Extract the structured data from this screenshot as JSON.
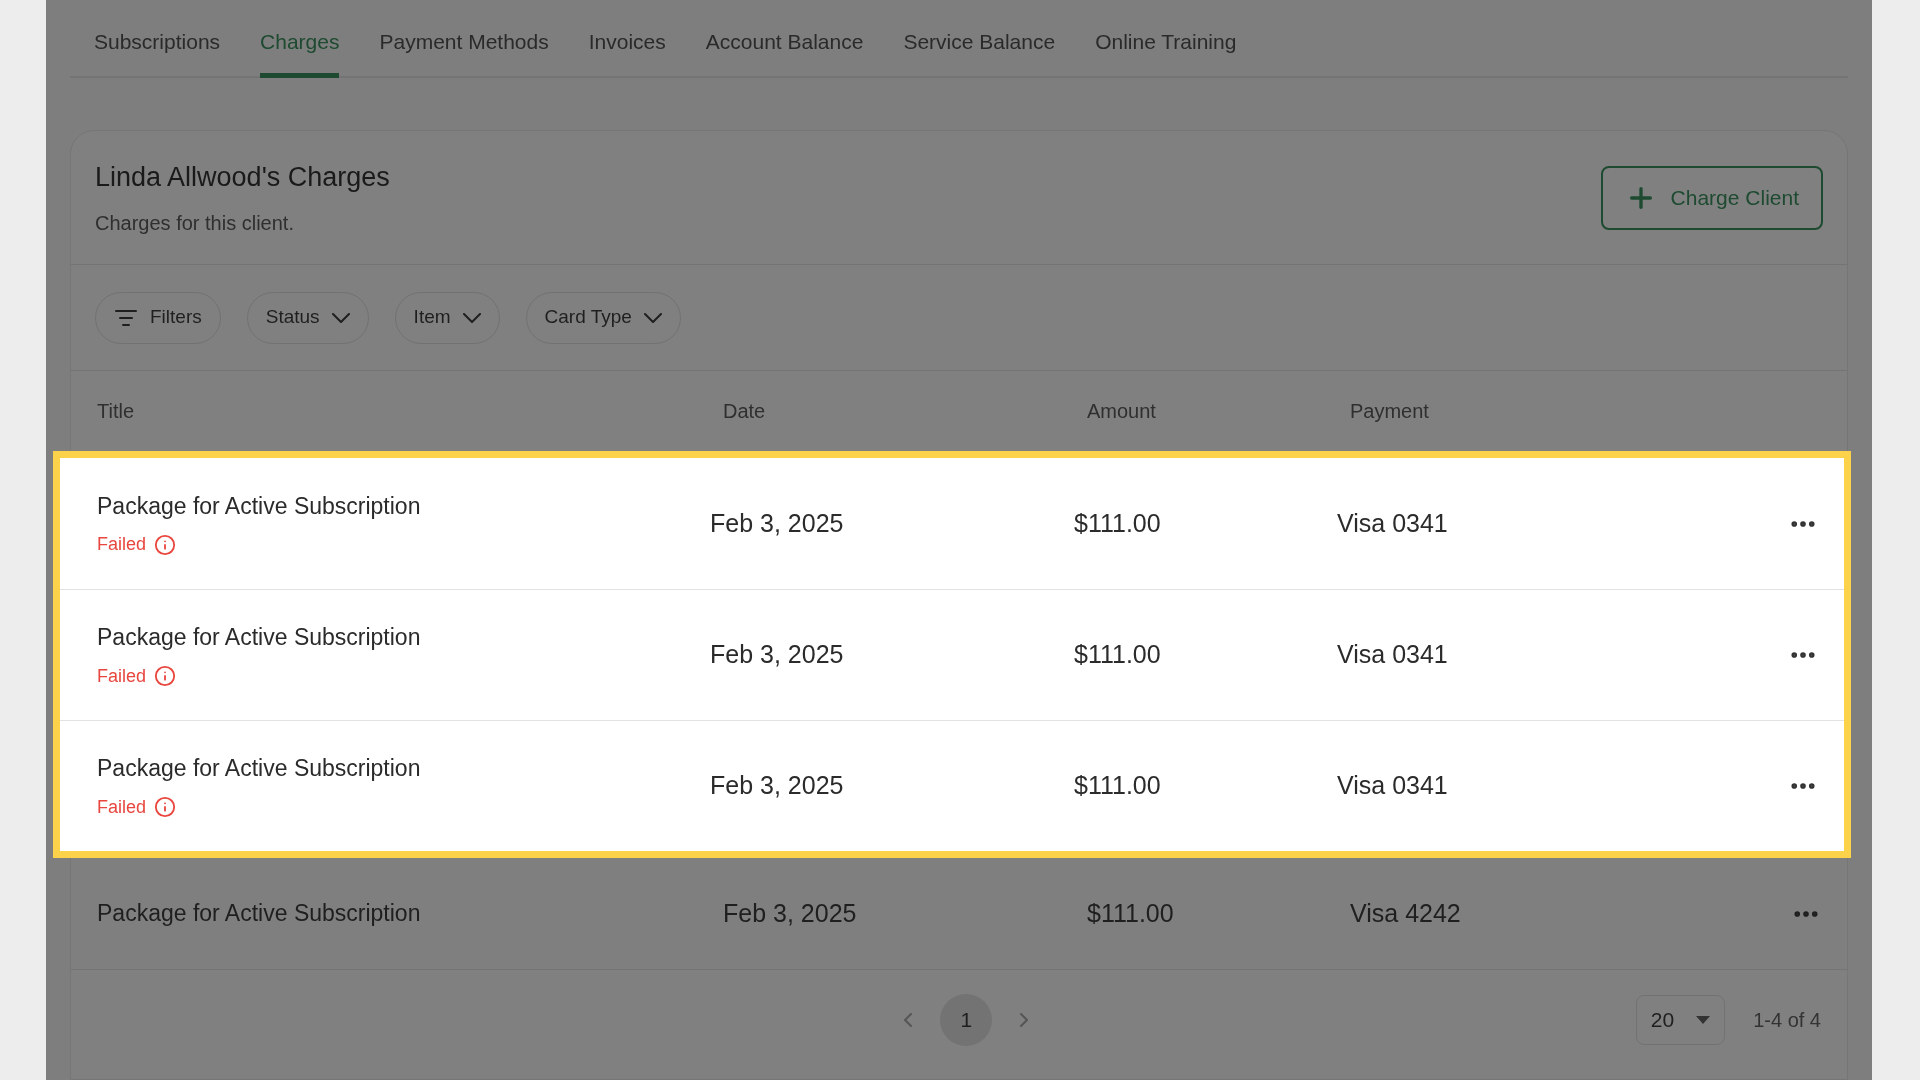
{
  "tabs": [
    {
      "label": "Subscriptions",
      "selected": false
    },
    {
      "label": "Charges",
      "selected": true
    },
    {
      "label": "Payment Methods",
      "selected": false
    },
    {
      "label": "Invoices",
      "selected": false
    },
    {
      "label": "Account Balance",
      "selected": false
    },
    {
      "label": "Service Balance",
      "selected": false
    },
    {
      "label": "Online Training",
      "selected": false
    }
  ],
  "card": {
    "title": "Linda Allwood's Charges",
    "subtitle": "Charges for this client.",
    "action_button": "Charge Client"
  },
  "filters": [
    {
      "label": "Filters",
      "kind": "filter"
    },
    {
      "label": "Status",
      "kind": "dropdown"
    },
    {
      "label": "Item",
      "kind": "dropdown"
    },
    {
      "label": "Card Type",
      "kind": "dropdown"
    }
  ],
  "table": {
    "columns": [
      "Title",
      "Date",
      "Amount",
      "Payment"
    ],
    "rows": [
      {
        "title": "Package for Active Subscription",
        "status": "Failed",
        "date": "Feb 3, 2025",
        "amount": "$111.00",
        "payment": "Visa 0341",
        "highlighted": true
      },
      {
        "title": "Package for Active Subscription",
        "status": "Failed",
        "date": "Feb 3, 2025",
        "amount": "$111.00",
        "payment": "Visa 0341",
        "highlighted": true
      },
      {
        "title": "Package for Active Subscription",
        "status": "Failed",
        "date": "Feb 3, 2025",
        "amount": "$111.00",
        "payment": "Visa 0341",
        "highlighted": true
      },
      {
        "title": "Package for Active Subscription",
        "date": "Feb 3, 2025",
        "amount": "$111.00",
        "payment": "Visa 4242",
        "highlighted": false
      }
    ]
  },
  "pagination": {
    "pages": [
      {
        "label": "1",
        "selected": true
      }
    ],
    "page_size": "20",
    "range": "1-4 of 4"
  }
}
